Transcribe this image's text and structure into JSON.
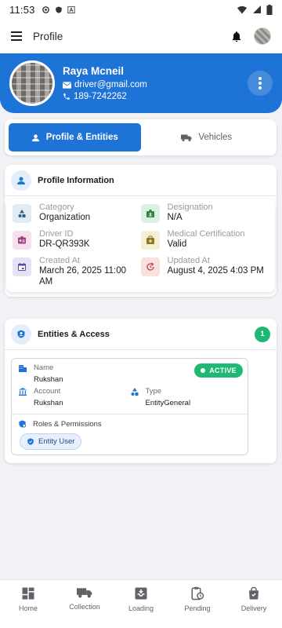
{
  "status_bar": {
    "time": "11:53"
  },
  "app_bar": {
    "title": "Profile"
  },
  "profile": {
    "name": "Raya Mcneil",
    "email": "driver@gmail.com",
    "phone": "189-7242262"
  },
  "tabs": [
    {
      "label": "Profile & Entities",
      "active": true,
      "icon": "person-icon"
    },
    {
      "label": "Vehicles",
      "active": false,
      "icon": "truck-icon"
    }
  ],
  "profile_info": {
    "title": "Profile Information",
    "fields": [
      {
        "label": "Category",
        "value": "Organization",
        "icon": "shapes-icon",
        "icon_bg": "#e2ecf5",
        "icon_color": "#2f5f86"
      },
      {
        "label": "Designation",
        "value": "N/A",
        "icon": "badge-icon",
        "icon_bg": "#dff0e2",
        "icon_color": "#2e8a43"
      },
      {
        "label": "Driver ID",
        "value": "DR-QR393K",
        "icon": "id-card-icon",
        "icon_bg": "#f5e1ee",
        "icon_color": "#a23d83"
      },
      {
        "label": "Medical Certification",
        "value": "Valid",
        "icon": "medical-kit-icon",
        "icon_bg": "#f3efd5",
        "icon_color": "#8a7b1f"
      },
      {
        "label": "Created At",
        "value": "March 26, 2025 11:00 AM",
        "icon": "calendar-icon",
        "icon_bg": "#e5e2f4",
        "icon_color": "#5a4aa6"
      },
      {
        "label": "Updated At",
        "value": "August 4, 2025 4:03 PM",
        "icon": "update-icon",
        "icon_bg": "#f8e1e1",
        "icon_color": "#c24040"
      }
    ]
  },
  "entities": {
    "title": "Entities & Access",
    "count": "1",
    "item": {
      "name_label": "Name",
      "name_value": "Rukshan",
      "status": "ACTIVE",
      "account_label": "Account",
      "account_value": "Rukshan",
      "type_label": "Type",
      "type_value": "EntityGeneral",
      "roles_label": "Roles & Permissions",
      "role_chip": "Entity User"
    }
  },
  "bottom_nav": [
    {
      "label": "Home",
      "icon": "dashboard-icon"
    },
    {
      "label": "Collection",
      "icon": "truck-icon"
    },
    {
      "label": "Loading",
      "icon": "inbox-icon"
    },
    {
      "label": "Pending",
      "icon": "clipboard-clock-icon"
    },
    {
      "label": "Delivery",
      "icon": "bag-icon"
    }
  ],
  "colors": {
    "primary": "#1e73d6",
    "success": "#1fb872",
    "background": "#f1f2f6"
  }
}
